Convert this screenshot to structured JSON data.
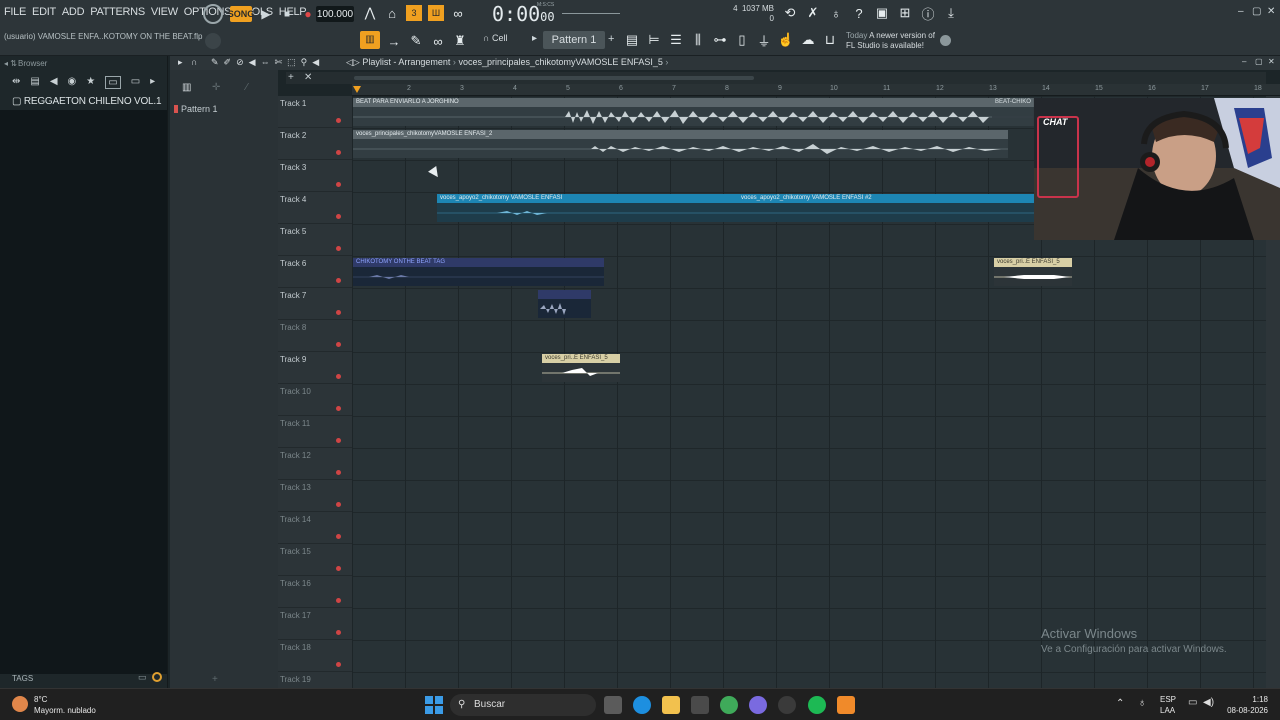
{
  "menu": [
    "FILE",
    "EDIT",
    "ADD",
    "PATTERNS",
    "VIEW",
    "OPTIONS",
    "TOOLS",
    "HELP"
  ],
  "transport": {
    "mode": "SONG",
    "tempo": "100.000",
    "time": "0:00",
    "time_sub": "00",
    "time_unit": "M:S:CS"
  },
  "cpu": {
    "voices": "4",
    "memory": "1037 MB",
    "cpu": "0"
  },
  "project": {
    "name": "(usuario) VAMOSLE ENFA..KOTOMY ON THE BEAT.flp"
  },
  "toolbar": {
    "snap": "Cell",
    "pattern": "Pattern 1"
  },
  "news": {
    "when": "Today",
    "message": "A newer version of FL Studio is available!"
  },
  "browser": {
    "title": "Browser",
    "folder": "REGGAETON CHILENO VOL.1",
    "tags": "TAGS"
  },
  "channels": {
    "pattern": "Pattern 1"
  },
  "playlist": {
    "title": "Playlist - Arrangement",
    "breadcrumb": "voces_principales_chikotomyVAMOSLE ENFASI_5"
  },
  "ruler": [
    "2",
    "3",
    "4",
    "5",
    "6",
    "7",
    "8",
    "9",
    "10",
    "11",
    "12",
    "13",
    "14",
    "15",
    "16",
    "17",
    "18"
  ],
  "tracks": [
    "Track 1",
    "Track 2",
    "Track 3",
    "Track 4",
    "Track 5",
    "Track 6",
    "Track 7",
    "Track 8",
    "Track 9",
    "Track 10",
    "Track 11",
    "Track 12",
    "Track 13",
    "Track 14",
    "Track 15",
    "Track 16",
    "Track 17",
    "Track 18",
    "Track 19"
  ],
  "clips": {
    "beat": "BEAT PARA ENVIARLO A JORGHINO",
    "beat_right": "BEAT-CHIKO",
    "vocals": "voces_principales_chikotomyVAMOSLE ENFASI_2",
    "apoyo1": "voces_apoyo2_chikotomy VAMOSLE ENFASI",
    "apoyo2": "voces_apoyo2_chikotomy VAMOSLE ENFASI #2",
    "tag": "CHIKOTOMY ONTHE BEAT TAG",
    "t7": "",
    "t9": "voces_pri..E ENFASI_5",
    "t6b": "voces_pri..E ENFASI_5"
  },
  "overlay": {
    "chat": "CHAT"
  },
  "watermark": {
    "line1": "Activar Windows",
    "line2": "Ve a Configuración para activar Windows."
  },
  "taskbar": {
    "temp": "8°C",
    "weather": "Mayorm. nublado",
    "search": "Buscar",
    "lang1": "ESP",
    "lang2": "LAA",
    "time": "1:18",
    "date": "08-08-2026"
  }
}
